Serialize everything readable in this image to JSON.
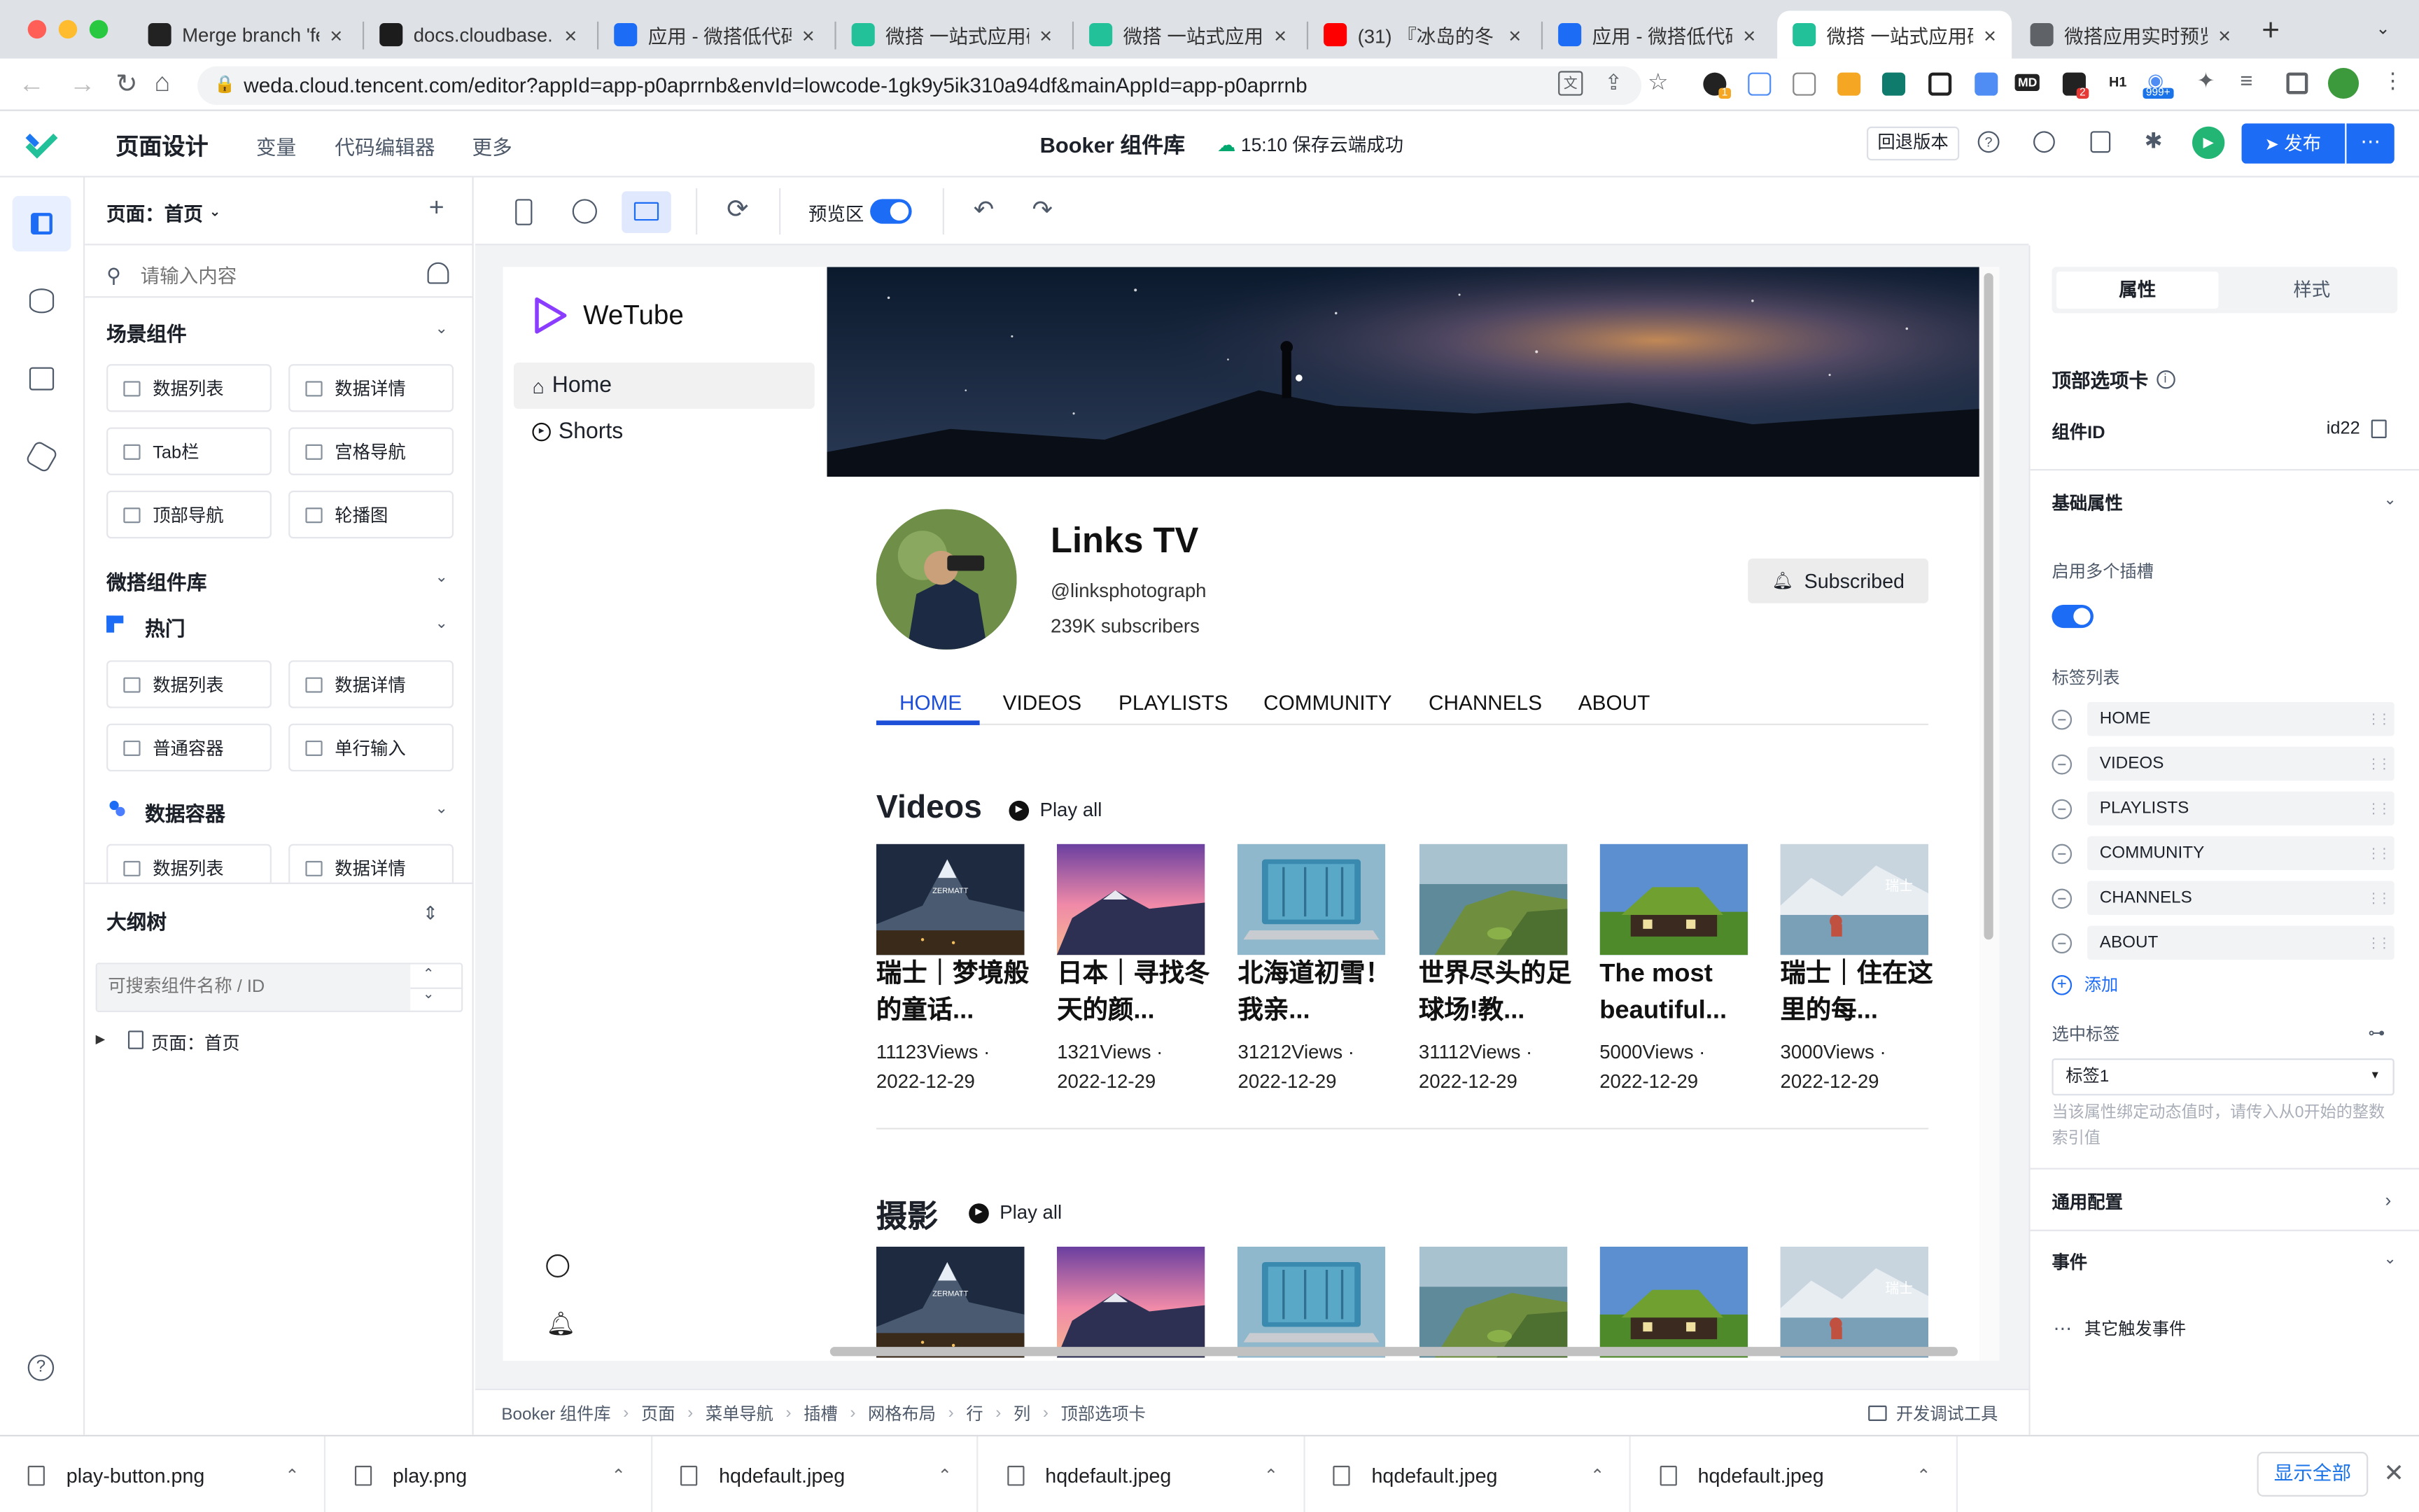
{
  "browser": {
    "tabs": [
      {
        "title": "Merge branch 'fea",
        "favicon": "github-icon",
        "active": false
      },
      {
        "title": "docs.cloudbase.ne",
        "favicon": "cloudbase-icon",
        "active": false
      },
      {
        "title": "应用 - 微搭低代码 -",
        "favicon": "cloud-icon",
        "active": false
      },
      {
        "title": "微搭 一站式应用研",
        "favicon": "weda-icon",
        "active": false
      },
      {
        "title": "微搭 一站式应用研",
        "favicon": "weda-icon",
        "active": false
      },
      {
        "title": "(31) 『冰岛的冬",
        "favicon": "youtube-icon",
        "active": false
      },
      {
        "title": "应用 - 微搭低代码 -",
        "favicon": "cloud-icon",
        "active": false
      },
      {
        "title": "微搭 一站式应用研",
        "favicon": "weda-icon",
        "active": true
      },
      {
        "title": "微搭应用实时预览",
        "favicon": "globe-icon",
        "active": false
      }
    ],
    "url": "weda.cloud.tencent.com/editor?appId=app-p0aprrnb&envId=lowcode-1gk9y5ik310a94df&mainAppId=app-p0aprrnb",
    "ext_badges": {
      "b1": "1",
      "b2": "2",
      "b3": "999+",
      "h1": "H1",
      "md": "MD"
    }
  },
  "header": {
    "title": "页面设计",
    "nav": [
      "变量",
      "代码编辑器",
      "更多"
    ],
    "app_name": "Booker 组件库",
    "save_status": "15:10 保存云端成功",
    "rollback": "回退版本",
    "publish": "发布"
  },
  "left_panel": {
    "page_selector": "页面：首页",
    "search_placeholder": "请输入内容",
    "scene_title": "场景组件",
    "scene_items": [
      "数据列表",
      "数据详情",
      "Tab栏",
      "宫格导航",
      "顶部导航",
      "轮播图"
    ],
    "lib_title": "微搭组件库",
    "hot_title": "热门",
    "hot_items": [
      "数据列表",
      "数据详情",
      "普通容器",
      "单行输入"
    ],
    "data_title": "数据容器",
    "data_items": [
      "数据列表",
      "数据详情"
    ],
    "outline_title": "大纲树",
    "outline_placeholder": "可搜索组件名称 / ID",
    "outline_node": "页面：首页"
  },
  "toolbar": {
    "preview_label": "预览区",
    "preview_on": true
  },
  "preview": {
    "brand": "WeTube",
    "nav": [
      "Home",
      "Shorts"
    ],
    "channel_name": "Links TV",
    "handle": "@linksphotograph",
    "subscribers": "239K subscribers",
    "subscribed": "Subscribed",
    "tabs": [
      "HOME",
      "VIDEOS",
      "PLAYLISTS",
      "COMMUNITY",
      "CHANNELS",
      "ABOUT"
    ],
    "sections": [
      {
        "title": "Videos",
        "play_all": "Play all",
        "videos": [
          {
            "title": "瑞士｜梦境般的童话...",
            "views": "11123Views ·",
            "date": "2022-12-29",
            "thumb": "matterhorn-thumb"
          },
          {
            "title": "日本｜寻找冬天的颜...",
            "views": "1321Views ·",
            "date": "2022-12-29",
            "thumb": "pink-sky-mountain-thumb"
          },
          {
            "title": "北海道初雪！我亲...",
            "views": "31212Views ·",
            "date": "2022-12-29",
            "thumb": "laptop-forest-thumb"
          },
          {
            "title": "世界尽头的足球场!教...",
            "views": "31112Views ·",
            "date": "2022-12-29",
            "thumb": "coast-field-thumb"
          },
          {
            "title": "The most beautiful...",
            "views": "5000Views ·",
            "date": "2022-12-29",
            "thumb": "green-roof-house-thumb"
          },
          {
            "title": "瑞士｜住在这里的每...",
            "views": "3000Views ·",
            "date": "2022-12-29",
            "thumb": "lake-mountain-thumb"
          }
        ]
      },
      {
        "title": "摄影",
        "play_all": "Play all"
      }
    ],
    "thumb_overlays": {
      "matterhorn": "ZERMATT",
      "lake": "瑞士"
    }
  },
  "right_panel": {
    "tabs": [
      "属性",
      "样式"
    ],
    "component_title": "顶部选项卡",
    "id_label": "组件ID",
    "id_value": "id22",
    "basic_title": "基础属性",
    "multi_slot_label": "启用多个插槽",
    "multi_slot_on": true,
    "tag_list_label": "标签列表",
    "tags": [
      "HOME",
      "VIDEOS",
      "PLAYLISTS",
      "COMMUNITY",
      "CHANNELS",
      "ABOUT"
    ],
    "add": "添加",
    "selected_label": "选中标签",
    "selected_value": "标签1",
    "hint": "当该属性绑定动态值时，请传入从0开始的整数索引值",
    "general": "通用配置",
    "events": "事件",
    "other_events": "其它触发事件"
  },
  "breadcrumb": {
    "items": [
      "Booker 组件库",
      "页面",
      "菜单导航",
      "插槽",
      "网格布局",
      "行",
      "列",
      "顶部选项卡"
    ],
    "devtools": "开发调试工具"
  },
  "downloads": {
    "items": [
      "play-button.png",
      "play.png",
      "hqdefault.jpeg",
      "hqdefault.jpeg",
      "hqdefault.jpeg",
      "hqdefault.jpeg"
    ],
    "show_all": "显示全部"
  },
  "colors": {
    "accent": "#0052d9",
    "wetube_purple": "#8b3dff",
    "tab_underline": "#1d4ed8"
  }
}
